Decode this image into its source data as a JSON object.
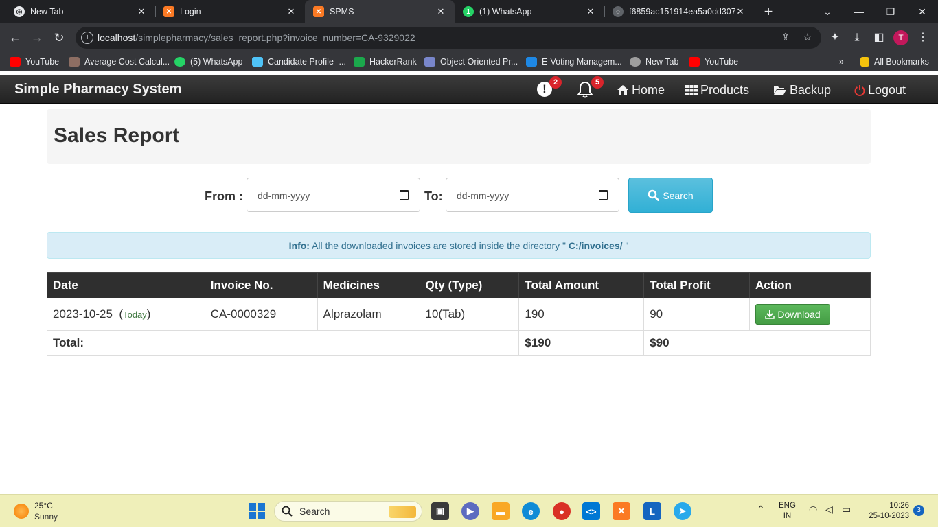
{
  "browser": {
    "tabs": [
      {
        "title": "New Tab",
        "active": false
      },
      {
        "title": "Login",
        "active": false
      },
      {
        "title": "SPMS",
        "active": true
      },
      {
        "title": "(1) WhatsApp",
        "active": false
      },
      {
        "title": "f6859ac151914ea5a0dd307",
        "active": false
      }
    ],
    "url_host": "localhost",
    "url_path": "/simplepharmacy/sales_report.php?invoice_number=CA-9329022",
    "profile_initial": "T",
    "bookmarks": [
      {
        "label": "YouTube",
        "color": "#ff0000"
      },
      {
        "label": "Average Cost Calcul...",
        "color": "#8d6e63"
      },
      {
        "label": "(5) WhatsApp",
        "color": "#25d366"
      },
      {
        "label": "Candidate Profile -...",
        "color": "#4fc3f7"
      },
      {
        "label": "HackerRank",
        "color": "#1ba94c"
      },
      {
        "label": "Object Oriented Pr...",
        "color": "#7986cb"
      },
      {
        "label": "E-Voting Managem...",
        "color": "#1e88e5"
      },
      {
        "label": "New Tab",
        "color": "#9e9e9e"
      },
      {
        "label": "YouTube",
        "color": "#ff0000"
      }
    ],
    "all_bookmarks": "All Bookmarks",
    "overflow": "»"
  },
  "navbar": {
    "brand": "Simple Pharmacy System",
    "alert_count": "2",
    "notification_count": "5",
    "links": {
      "home": "Home",
      "products": "Products",
      "backup": "Backup",
      "logout": "Logout"
    }
  },
  "page": {
    "title": "Sales Report",
    "from_label": "From :",
    "to_label": "To:",
    "date_placeholder": "dd-mm-yyyy",
    "search_label": "Search",
    "info_prefix": "Info:",
    "info_text": " All the downloaded invoices are stored inside the directory \" ",
    "info_path": "C:/invoices/",
    "info_suffix": " \""
  },
  "table": {
    "headers": [
      "Date",
      "Invoice No.",
      "Medicines",
      "Qty (Type)",
      "Total Amount",
      "Total Profit",
      "Action"
    ],
    "rows": [
      {
        "date": "2023-10-25",
        "today_open": "(",
        "today": "Today",
        "today_close": ")",
        "invoice": "CA-0000329",
        "medicine": "Alprazolam",
        "qty": "10(Tab)",
        "amount": "190",
        "profit": "90",
        "action": "Download"
      }
    ],
    "total_label": "Total:",
    "total_amount": "$190",
    "total_profit": "$90"
  },
  "taskbar": {
    "temperature": "25°C",
    "weather": "Sunny",
    "search_label": "Search",
    "language_1": "ENG",
    "language_2": "IN",
    "time": "10:26",
    "date": "25-10-2023",
    "notification_count": "3"
  }
}
